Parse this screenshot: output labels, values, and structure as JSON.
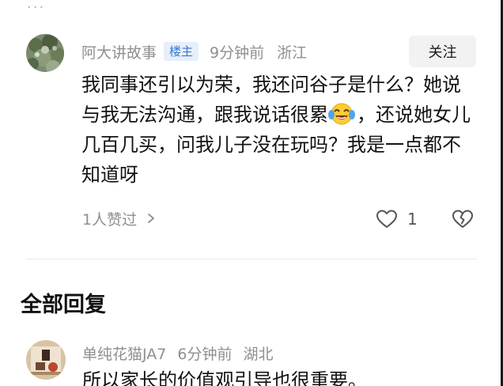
{
  "top_hint": "...",
  "comment": {
    "username": "阿大讲故事",
    "badge": "楼主",
    "time": "9分钟前",
    "location": "浙江",
    "follow_label": "关注",
    "text_part1": "我同事还引以为荣，我还问谷子是什么？她说与我无法沟通，跟我说话很累",
    "emoji_icon": "crying-laughing-emoji-icon",
    "text_part2": "，还说她女儿几百几买，问我儿子没在玩吗？我是一点都不知道呀",
    "likes_text": "1人赞过",
    "like_count": "1"
  },
  "section": {
    "title": "全部回复"
  },
  "reply": {
    "username": "单纯花猫JA7",
    "time": "6分钟前",
    "location": "湖北",
    "text": "所以家长的价值观引导也很重要。"
  },
  "colors": {
    "meta_gray": "#8f8f8f",
    "badge_blue": "#3a79c9",
    "badge_bg": "#e6effb",
    "button_bg": "#f2f2f2",
    "text": "#121212"
  }
}
